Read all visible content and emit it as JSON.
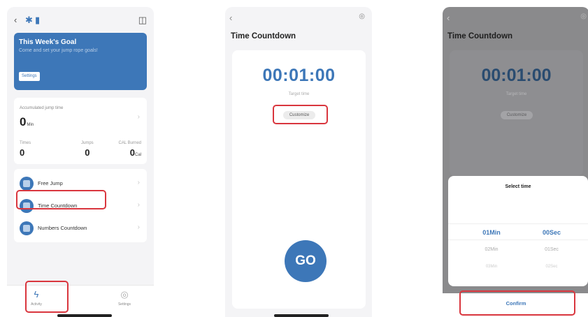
{
  "screen1": {
    "icons": {
      "back": "chevron-left-icon",
      "bluetooth": "bluetooth-icon",
      "battery": "battery-icon",
      "device": "device-icon"
    },
    "goal": {
      "title": "This Week's Goal",
      "subtitle": "Come and set your jump rope goals!",
      "button": "Settings"
    },
    "stats": {
      "accumulated_label": "Accumulated jump time",
      "accumulated_value": "0",
      "accumulated_unit": "Min",
      "times_label": "Times",
      "times_value": "0",
      "jumps_label": "Jumps",
      "jumps_value": "0",
      "cal_label": "CAL Burned",
      "cal_value": "0",
      "cal_unit": "Cal"
    },
    "menu": [
      {
        "label": "Free Jump",
        "icon": "free-jump-icon"
      },
      {
        "label": "Time Countdown",
        "icon": "time-countdown-icon"
      },
      {
        "label": "Numbers Countdown",
        "icon": "numbers-countdown-icon"
      }
    ],
    "tabs": [
      {
        "label": "Activity",
        "icon": "activity-icon"
      },
      {
        "label": "Settings",
        "icon": "settings-icon"
      }
    ]
  },
  "screen2": {
    "title": "Time Countdown",
    "time": "00:01:00",
    "target_label": "Target time",
    "customize": "Customize",
    "go": "GO"
  },
  "screen3": {
    "title": "Time Countdown",
    "time": "00:01:00",
    "target_label": "Target time",
    "customize": "Customize",
    "picker_title": "Select time",
    "minutes": [
      "01Min",
      "02Min",
      "03Min"
    ],
    "seconds": [
      "00Sec",
      "01Sec",
      "02Sec"
    ],
    "confirm": "Confirm"
  },
  "colors": {
    "accent": "#3d77b8",
    "highlight": "#d9363e",
    "overlay": "#8a8a8c"
  }
}
